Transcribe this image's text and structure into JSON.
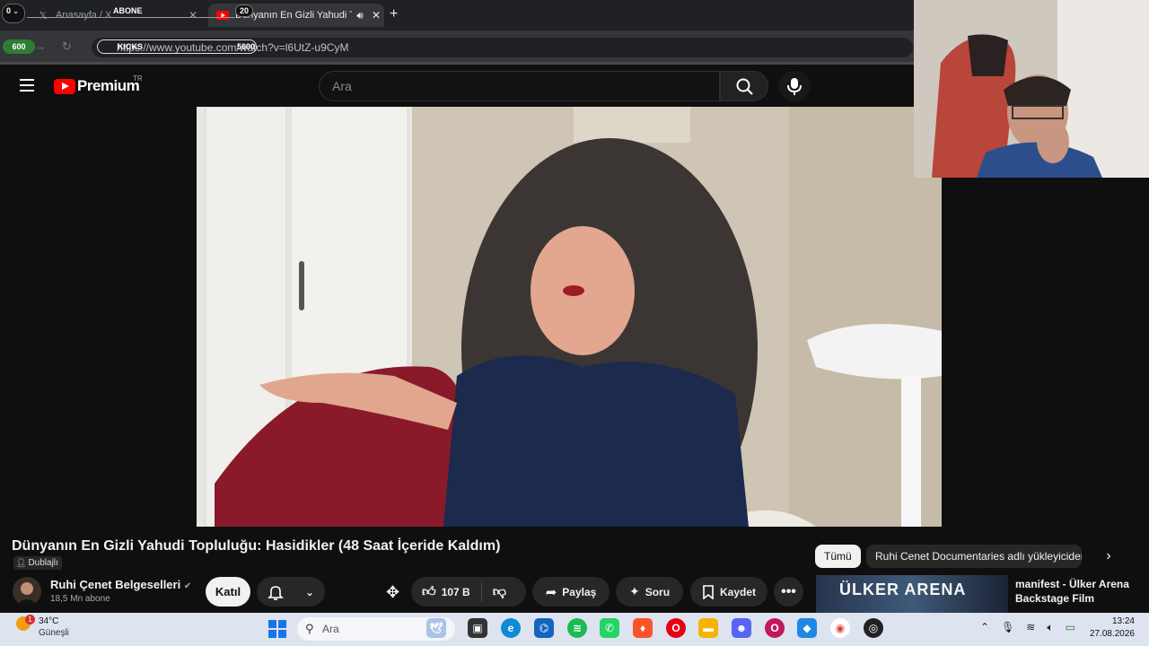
{
  "browser": {
    "tabs": [
      {
        "title": "Anasayfa / X",
        "icon": "x-logo-icon"
      },
      {
        "title": "Dünyanın En Gizli Yahudi To",
        "icon": "youtube-favicon-icon",
        "audio": "speaker-icon"
      }
    ],
    "url": "https://www.youtube.com/watch?v=l6UtZ-u9CyM"
  },
  "overlays": {
    "counter_top": "0",
    "abone_label": "ABONE",
    "abone_count": "20",
    "progress_left": "600",
    "kicks_label": "KICKS",
    "kicks_goal": "5000"
  },
  "youtube": {
    "brand": "Premium",
    "country": "TR",
    "search_placeholder": "Ara",
    "video_title": "Dünyanın En Gizli Yahudi Topluluğu: Hasidikler (48 Saat İçeride Kaldım)",
    "dub_badge": "Dublajlı",
    "channel_name": "Ruhi Çenet Belgeselleri",
    "subscribers": "18,5 Mn abone",
    "join_label": "Katıl",
    "likes": "107 B",
    "share_label": "Paylaş",
    "ask_label": "Soru",
    "save_label": "Kaydet",
    "chips": [
      "Tümü",
      "Ruhi Cenet Documentaries adlı yükleyiciden"
    ],
    "rec_thumb_text": "ÜLKER ARENA",
    "rec_title": "manifest - Ülker Arena Backstage Film"
  },
  "taskbar": {
    "weather_badge": "1",
    "temperature": "34°C",
    "condition": "Güneşli",
    "search_placeholder": "Ara",
    "time": "13:24",
    "date": "27.08.2026"
  },
  "colors": {
    "accent_red": "#ff0000",
    "bg": "#0f0f0f",
    "taskbar": "#dde4ef"
  }
}
